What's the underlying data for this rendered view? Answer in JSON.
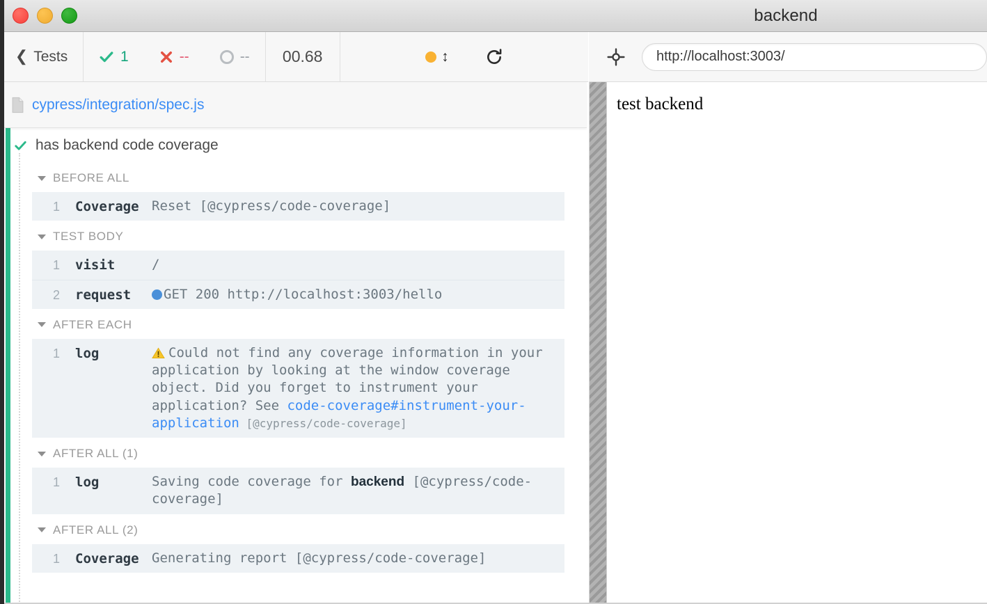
{
  "window": {
    "title": "backend",
    "traffic_lights": [
      "close-red",
      "minimize-yellow",
      "maximize-green"
    ]
  },
  "reporter_header": {
    "back_label": "Tests",
    "back_icon": "chevron-left-icon",
    "stats": [
      {
        "key": "passed",
        "icon": "check-icon",
        "value": "1",
        "color": "#14a57c"
      },
      {
        "key": "failed",
        "icon": "x-icon",
        "value": "--",
        "color": "#e45770"
      },
      {
        "key": "pending",
        "icon": "circle-icon",
        "value": "--",
        "color": "#9aa0a6"
      }
    ],
    "duration": "00.68",
    "controls": {
      "pause_icon": "pause-dot-icon",
      "next_icon": "up-down-arrow-icon",
      "restart_icon": "restart-icon"
    }
  },
  "aut_header": {
    "selector_icon": "crosshair-selector-icon",
    "url": "http://localhost:3003/",
    "url_placeholder": "http://localhost:3003/"
  },
  "spec": {
    "file_icon": "file-icon",
    "path": "cypress/integration/spec.js"
  },
  "test": {
    "status_icon": "check-icon",
    "title": "has backend code coverage",
    "accent_color": "#2bb98a"
  },
  "hooks": [
    {
      "label": "BEFORE ALL",
      "commands": [
        {
          "num": "1",
          "name": "Coverage",
          "message_parts": [
            {
              "type": "text",
              "text": "Reset [@cypress/code-coverage]"
            }
          ]
        }
      ]
    },
    {
      "label": "TEST BODY",
      "commands": [
        {
          "num": "1",
          "name": "visit",
          "message_parts": [
            {
              "type": "text",
              "text": "/"
            }
          ]
        },
        {
          "num": "2",
          "name": "request",
          "message_parts": [
            {
              "type": "dot"
            },
            {
              "type": "text",
              "text": "GET 200 http://localhost:3003/hello"
            }
          ]
        }
      ]
    },
    {
      "label": "AFTER EACH",
      "commands": [
        {
          "num": "1",
          "name": "log",
          "message_parts": [
            {
              "type": "warn"
            },
            {
              "type": "text",
              "text": "Could not find any coverage information in your application by looking at the window coverage object. Did you forget to instrument your application? See "
            },
            {
              "type": "link",
              "text": "code-coverage#instrument-your-application"
            },
            {
              "type": "small",
              "text": " [@cypress/code-coverage]"
            }
          ]
        }
      ]
    },
    {
      "label": "AFTER ALL (1)",
      "commands": [
        {
          "num": "1",
          "name": "log",
          "message_parts": [
            {
              "type": "text",
              "text": "Saving code coverage for "
            },
            {
              "type": "boldsans",
              "text": "backend"
            },
            {
              "type": "text",
              "text": " [@cypress/code-coverage]"
            }
          ]
        }
      ]
    },
    {
      "label": "AFTER ALL (2)",
      "commands": [
        {
          "num": "1",
          "name": "Coverage",
          "message_parts": [
            {
              "type": "text",
              "text": "Generating report [@cypress/code-coverage]"
            }
          ]
        }
      ]
    }
  ],
  "aut": {
    "body_text": "test backend"
  }
}
